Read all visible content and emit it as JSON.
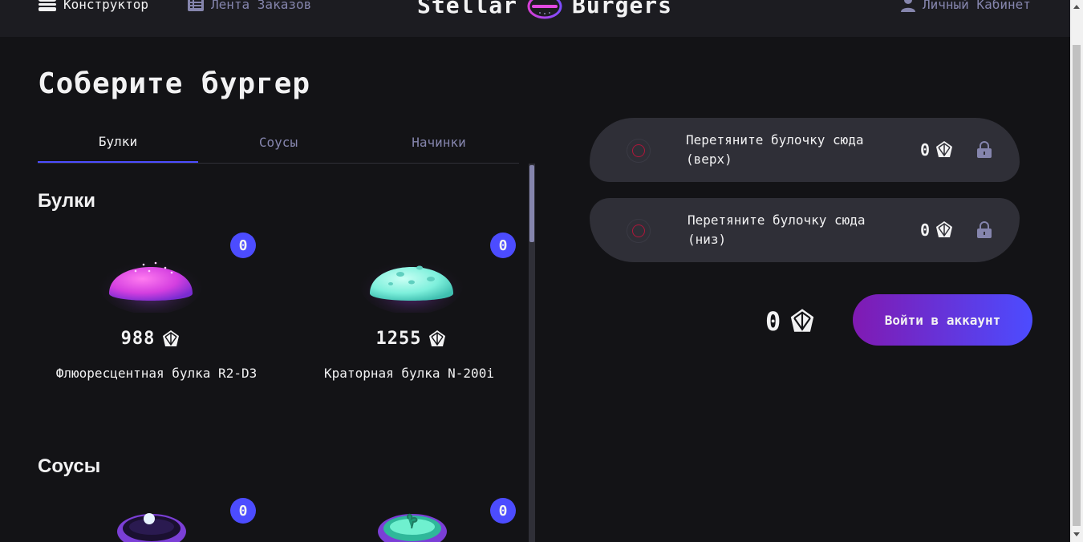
{
  "header": {
    "nav_constructor": "Конструктор",
    "nav_feed": "Лента Заказов",
    "logo_left": "Stellar",
    "logo_right": "Burgers",
    "nav_account": "Личный Кабинет"
  },
  "page_title": "Соберите бургер",
  "tabs": [
    {
      "label": "Булки"
    },
    {
      "label": "Соусы"
    },
    {
      "label": "Начинки"
    }
  ],
  "sections": {
    "buns": {
      "title": "Булки",
      "items": [
        {
          "name": "Флюоресцентная булка R2-D3",
          "price": "988",
          "count": "0",
          "icon": "fluorescent-bun-image"
        },
        {
          "name": "Краторная булка N-200i",
          "price": "1255",
          "count": "0",
          "icon": "crater-bun-image"
        }
      ]
    },
    "sauces": {
      "title": "Соусы",
      "items": [
        {
          "count": "0",
          "icon": "sauce-spicy-image"
        },
        {
          "count": "0",
          "icon": "sauce-green-image"
        }
      ]
    }
  },
  "constructor": {
    "top_slot_text": "Перетяните булочку сюда (верх)",
    "bottom_slot_text": "Перетяните булочку сюда (низ)",
    "top_price": "0",
    "bottom_price": "0",
    "total": "0",
    "login_button": "Войти в аккаунт"
  },
  "colors": {
    "background": "#131316",
    "header": "#1c1c21",
    "accent": "#4c4cff",
    "inactive": "#8585ad",
    "slot": "#2f2f37",
    "button_gradient_start": "#801ab2"
  }
}
